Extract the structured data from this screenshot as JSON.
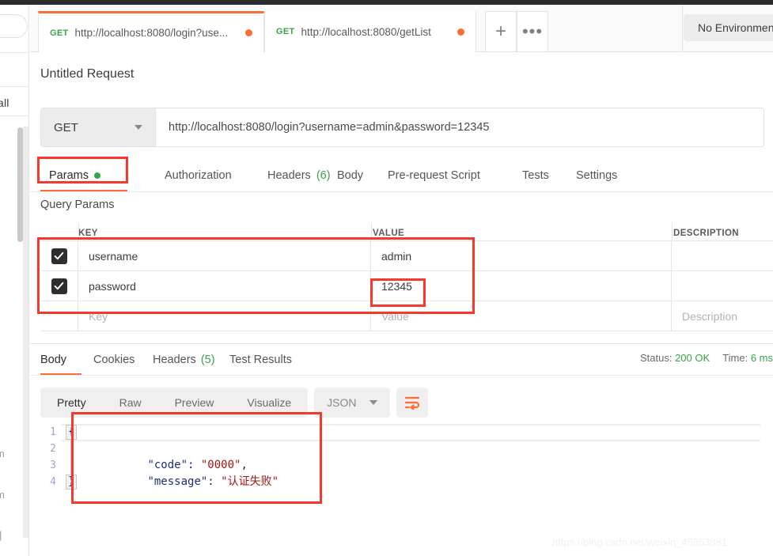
{
  "window": {
    "environment_selector": "No Environment"
  },
  "request_tabs": [
    {
      "method": "GET",
      "url": "http://localhost:8080/login?use...",
      "unsaved": true,
      "active": true
    },
    {
      "method": "GET",
      "url": "http://localhost:8080/getList",
      "unsaved": true,
      "active": false
    }
  ],
  "tabbar_buttons": {
    "new_tab": "+",
    "more": "•••"
  },
  "request": {
    "title": "Untitled Request",
    "method": "GET",
    "url": "http://localhost:8080/login?username=admin&password=12345"
  },
  "request_tab_strip": [
    {
      "label": "Params",
      "badge": "dot",
      "active": true
    },
    {
      "label": "Authorization",
      "badge": "",
      "active": false
    },
    {
      "label": "Headers",
      "badge": "(6)",
      "active": false
    },
    {
      "label": "Body",
      "badge": "",
      "active": false
    },
    {
      "label": "Pre-request Script",
      "badge": "",
      "active": false
    },
    {
      "label": "Tests",
      "badge": "",
      "active": false
    },
    {
      "label": "Settings",
      "badge": "",
      "active": false
    }
  ],
  "query_params": {
    "section_title": "Query Params",
    "columns": [
      "KEY",
      "VALUE",
      "DESCRIPTION"
    ],
    "rows": [
      {
        "enabled": true,
        "key": "username",
        "value": "admin",
        "description": ""
      },
      {
        "enabled": true,
        "key": "password",
        "value": "12345",
        "description": ""
      }
    ],
    "placeholder_row": {
      "key": "Key",
      "value": "Value",
      "description": "Description"
    }
  },
  "response": {
    "tabs": [
      {
        "label": "Body",
        "badge": "",
        "active": true
      },
      {
        "label": "Cookies",
        "badge": "",
        "active": false
      },
      {
        "label": "Headers",
        "badge": "(5)",
        "active": false
      },
      {
        "label": "Test Results",
        "badge": "",
        "active": false
      }
    ],
    "status_label": "Status:",
    "status_value": "200 OK",
    "time_label": "Time:",
    "time_value": "6 ms",
    "view_modes": [
      "Pretty",
      "Raw",
      "Preview",
      "Visualize"
    ],
    "active_view_mode": "Pretty",
    "format": "JSON",
    "wrap_icon": "word-wrap-icon",
    "body_lines": [
      {
        "n": "1",
        "text": "{"
      },
      {
        "n": "2",
        "key": "\"code\"",
        "sep": ": ",
        "value": "\"0000\"",
        "tail": ","
      },
      {
        "n": "3",
        "key": "\"message\"",
        "sep": ": ",
        "value": "\"认证失败\"",
        "tail": ""
      },
      {
        "n": "4",
        "text": "}"
      }
    ]
  },
  "sidebar": {
    "fragment_all": "all",
    "fragments": [
      "m",
      "m",
      "|"
    ]
  },
  "watermark": "https://blog.csdn.net/weixin_45853881",
  "colors": {
    "accent": "#ff6c37",
    "green": "#3aa34a",
    "annotation": "#f5392e",
    "json_key": "#1f2d7a",
    "json_value": "#a31515"
  }
}
